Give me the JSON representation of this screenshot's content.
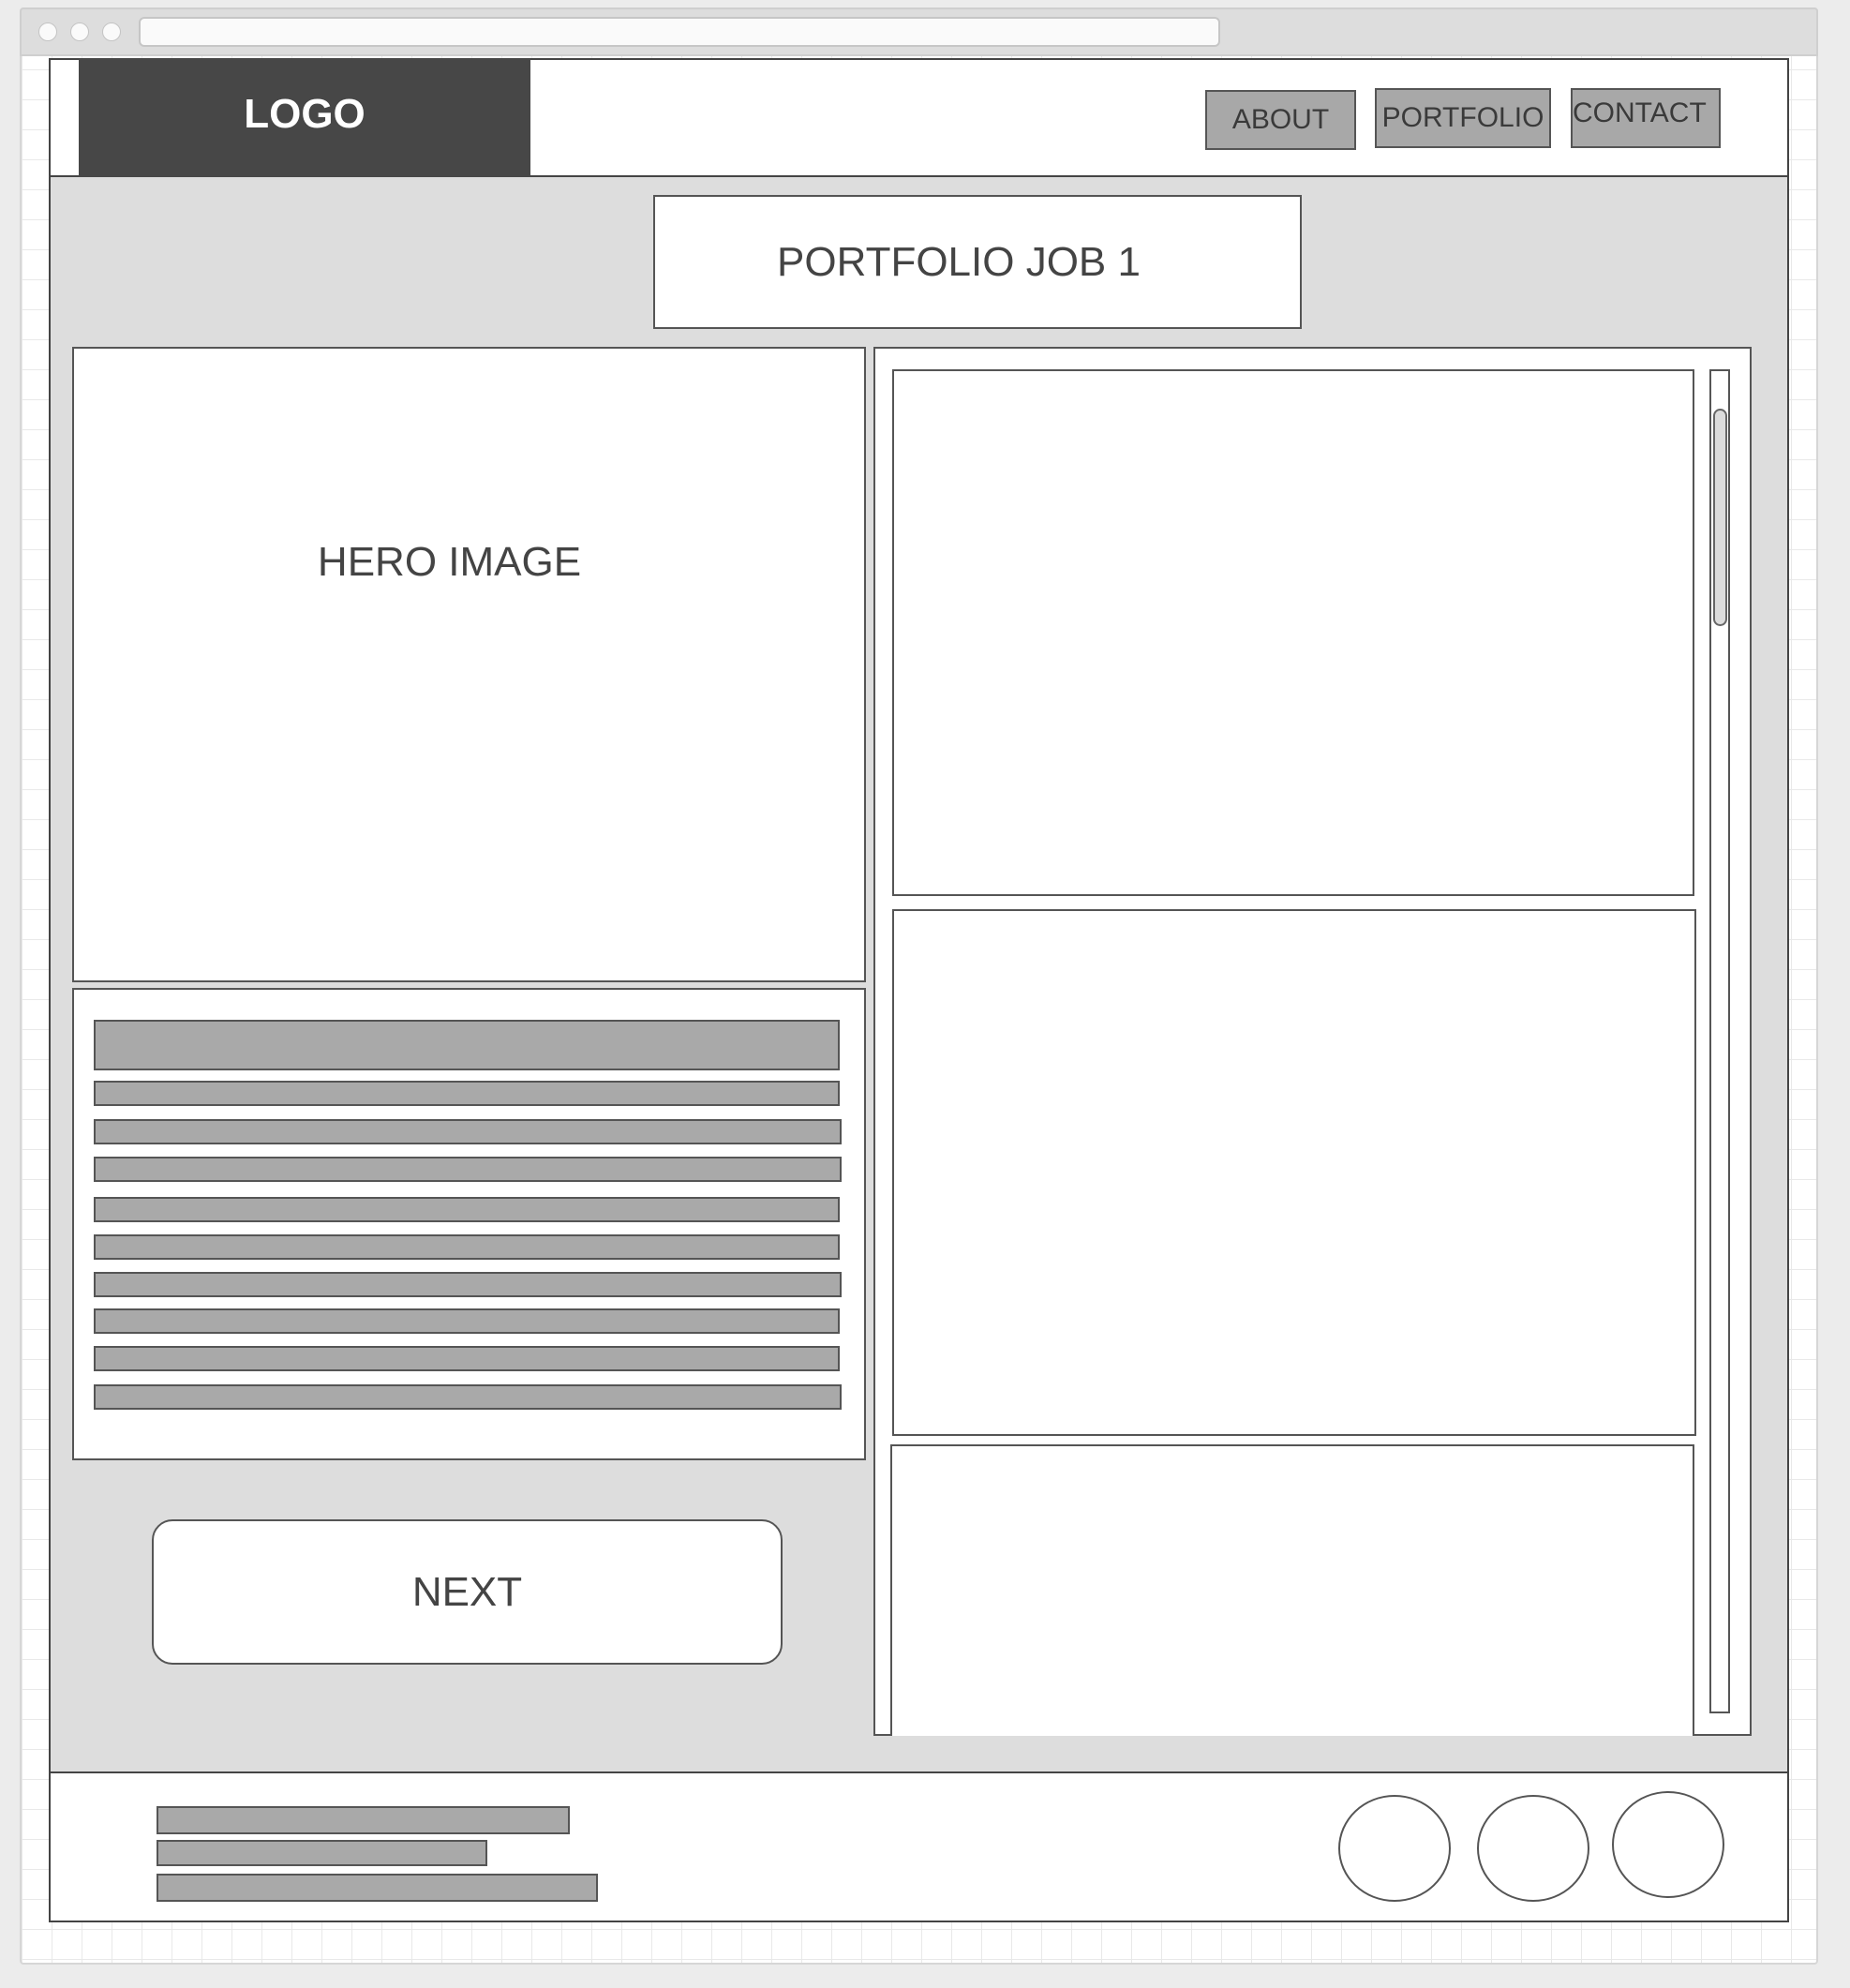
{
  "header": {
    "logo_text": "LOGO",
    "nav": [
      {
        "label": "ABOUT"
      },
      {
        "label": "PORTFOLIO"
      },
      {
        "label": "CONTACT"
      }
    ]
  },
  "main": {
    "page_title": "PORTFOLIO JOB 1",
    "hero_label": "HERO IMAGE",
    "next_label": "NEXT"
  },
  "colors": {
    "logo_bg": "#474747",
    "button_fill": "#a8a8a8",
    "content_bg": "#dddddd",
    "outline": "#444444"
  }
}
